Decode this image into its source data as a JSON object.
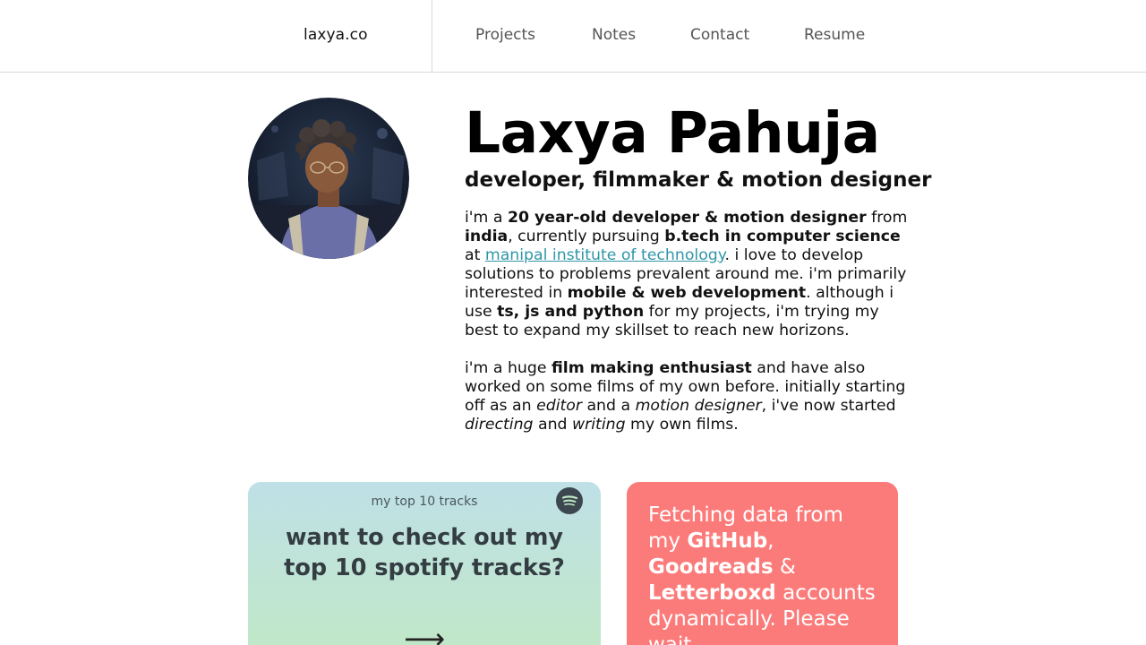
{
  "nav": {
    "brand": "laxya.co",
    "links": [
      {
        "label": "Projects"
      },
      {
        "label": "Notes"
      },
      {
        "label": "Contact"
      },
      {
        "label": "Resume"
      }
    ]
  },
  "profile": {
    "name": "Laxya Pahuja",
    "tagline": "developer, filmmaker & motion designer",
    "bio1": {
      "t1": "i'm a ",
      "b1": "20 year-old developer & motion designer",
      "t2": " from ",
      "b2": "india",
      "t3": ", currently pursuing ",
      "b3": "b.tech in computer science",
      "t4": " at ",
      "link": "manipal institute of technology",
      "t5": ". i love to develop solutions to problems prevalent around me. i'm primarily interested in ",
      "b4": "mobile & web development",
      "t6": ". although i use ",
      "b5": "ts, js and python",
      "t7": " for my projects, i'm trying my best to expand my skillset to reach new horizons."
    },
    "bio2": {
      "t1": "i'm a huge ",
      "b1": "film making enthusiast",
      "t2": " and have also worked on some films of my own before. initially starting off as an ",
      "i1": "editor",
      "t3": " and a ",
      "i2": "motion designer",
      "t4": ", i've now started ",
      "i3": "directing",
      "t5": " and ",
      "i4": "writing",
      "t6": " my own films."
    }
  },
  "spotify_card": {
    "kicker": "my top 10 tracks",
    "question": "want to check out my top 10 spotify tracks?",
    "arrow": "⟶",
    "icon": "spotify-icon"
  },
  "loading_card": {
    "t1": "Fetching data from my ",
    "b1": "GitHub",
    "t2": ", ",
    "b2": "Goodreads",
    "t3": " & ",
    "b3": "Letterboxd",
    "t4": " accounts dynamically. Please wait..."
  },
  "colors": {
    "link": "#2f96a8",
    "loading_card": "#fb7b7a",
    "spotify_gradient_top": "#bfe0e6",
    "spotify_gradient_bottom": "#c1e8c6"
  }
}
